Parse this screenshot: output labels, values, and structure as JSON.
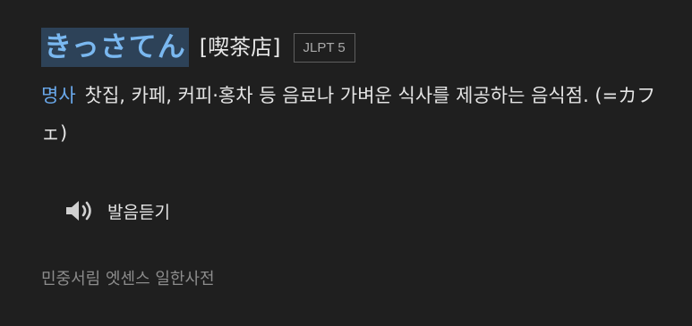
{
  "entry": {
    "headword": "きっさてん",
    "kanji": "[喫茶店]",
    "jlpt_level": "JLPT 5",
    "part_of_speech": "명사",
    "definition": "찻집, 카페, 커피·홍차 등 음료나 가벼운 식사를 제공하는 음식점. (=カフェ)"
  },
  "audio": {
    "icon": "speaker-icon",
    "label": "발음듣기"
  },
  "source": {
    "label": "민중서림 엣센스 일한사전"
  },
  "colors": {
    "background": "#1f1f1f",
    "headword_text": "#7ab8f0",
    "headword_highlight": "#2d4258",
    "part_of_speech": "#6aa9ec",
    "muted_text": "#8c8c8c"
  }
}
